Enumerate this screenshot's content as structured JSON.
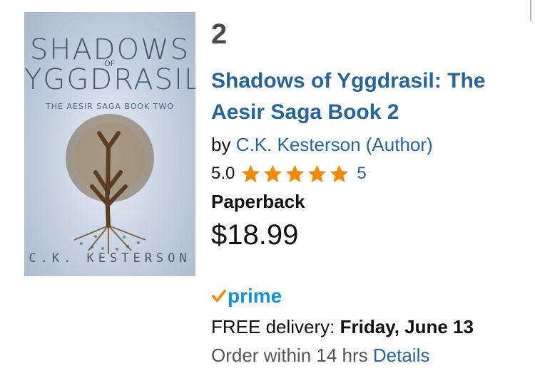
{
  "result": {
    "rank": "2",
    "cover": {
      "title_line1": "SHADOWS",
      "title_of": "OF",
      "title_line2": "YGGDRASIL",
      "subtitle": "THE AESIR SAGA BOOK TWO",
      "author": "C.K. KESTERSON"
    },
    "title": "Shadows of Yggdrasil: The Aesir Saga Book 2",
    "by_prefix": "by ",
    "author": "C.K. Kesterson (Author)",
    "rating_value": "5.0",
    "rating_stars": 5,
    "review_count": "5",
    "format": "Paperback",
    "price": "$18.99",
    "prime_label": "prime",
    "delivery_prefix": "FREE delivery: ",
    "delivery_date": "Friday, June 13",
    "order_text": "Order within 14 hrs ",
    "details_link": "Details"
  },
  "colors": {
    "link": "#2a6496",
    "star": "#f08a0c",
    "prime_blue": "#1a8fd6",
    "prime_check": "#f08a0c"
  },
  "icons": [
    "star-icon",
    "prime-check-icon"
  ]
}
